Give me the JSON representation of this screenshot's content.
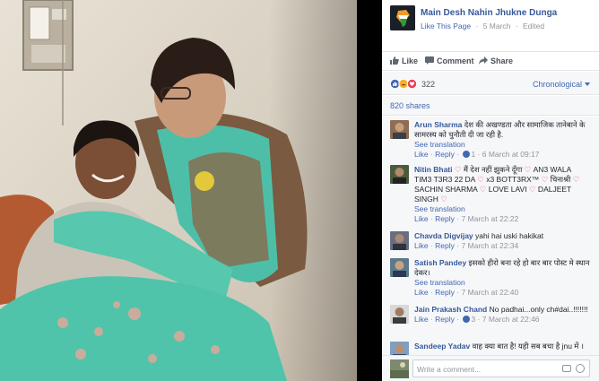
{
  "post": {
    "page_name": "Main Desh Nahin Jhukne Dunga",
    "like_page": "Like This Page",
    "date": "5 March",
    "edited": "Edited",
    "separator": "·"
  },
  "actions": {
    "like": "Like",
    "comment": "Comment",
    "share": "Share"
  },
  "reactions": {
    "count": "322",
    "sort": "Chronological"
  },
  "shares": "820 shares",
  "comments": [
    {
      "author": "Arun Sharma",
      "text": "देश की अखण्डता और सामाजिक तानेबाने के सामरस्य को चुनौती दी जा रही है.",
      "see_translation": "See translation",
      "like": "Like",
      "reply": "Reply",
      "likes": "1",
      "time": "6 March at 09:17"
    },
    {
      "author": "Nitin Bhati",
      "text_parts": [
        "♡",
        " मैं देश नहीं झुकने दूँगा ",
        "♡",
        " AN3 WALA TIM3 T3R3 22 DA ",
        "♡",
        " x3 BOTT3RX™ ",
        "♡",
        " चिनाश्री ",
        "♡",
        " SACHIN SHARMA ",
        "♡",
        " LOVE LAVI ",
        "♡",
        " DALJEET SINGH ",
        "♡"
      ],
      "see_translation": "See translation",
      "like": "Like",
      "reply": "Reply",
      "time": "7 March at 22:22"
    },
    {
      "author": "Chavda Digvijay",
      "text": "yahi hai uski hakikat",
      "like": "Like",
      "reply": "Reply",
      "time": "7 March at 22:34"
    },
    {
      "author": "Satish Pandey",
      "text": "इसको हीरो बना रहे हो बार बार पोस्ट मे स्थान देकर।",
      "see_translation": "See translation",
      "like": "Like",
      "reply": "Reply",
      "time": "7 March at 22:40"
    },
    {
      "author": "Jain Prakash Chand",
      "text": "No padhai...only ch#dai..!!!!!!!",
      "like": "Like",
      "reply": "Reply",
      "likes": "3",
      "time": "7 March at 22:46"
    },
    {
      "author": "Sandeep Yadav",
      "text": "वाह क्या बात है! यही सब बचा है jnu में ।"
    }
  ],
  "write_comment": {
    "placeholder": "Write a comment..."
  },
  "colors": {
    "link": "#365899",
    "blue": "#4267b2",
    "grey": "#90949c",
    "heart": "#e83d56",
    "panel_bg": "#f6f7f9"
  },
  "icons": [
    "india-map-icon",
    "thumbs-up-icon",
    "comment-bubble-icon",
    "share-arrow-icon",
    "like-reaction-icon",
    "haha-reaction-icon",
    "love-reaction-icon",
    "chevron-down-icon",
    "camera-icon",
    "emoji-icon"
  ]
}
